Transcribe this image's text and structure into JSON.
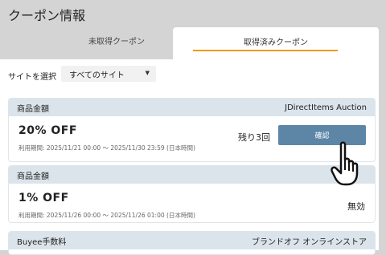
{
  "page": {
    "title": "クーポン情報"
  },
  "tabs": [
    {
      "label": "未取得クーポン",
      "active": false
    },
    {
      "label": "取得済みクーポン",
      "active": true
    }
  ],
  "filter": {
    "label": "サイトを選択",
    "selected": "すべてのサイト"
  },
  "coupons": [
    {
      "category": "商品金額",
      "site": "JDirectItems Auction",
      "discount": "20%  OFF",
      "period": "利用期間: 2025/11/21 00:00 ～ 2025/11/30 23:59 (日本時間)",
      "remaining": "残り3回",
      "action_label": "確認"
    },
    {
      "category": "商品金額",
      "site": "",
      "discount": "1%  OFF",
      "period": "利用期間: 2025/11/26 00:00 ～ 2025/11/26 01:00 (日本時間)",
      "status": "無効"
    },
    {
      "category": "Buyee手数料",
      "site": "ブランドオフ オンラインストア"
    }
  ],
  "colors": {
    "accent": "#f39800",
    "button": "#5d86a6",
    "card_header": "#dbe4eb"
  },
  "icons": {
    "cursor": "hand-pointer-icon",
    "select": "caret-down-icon"
  }
}
